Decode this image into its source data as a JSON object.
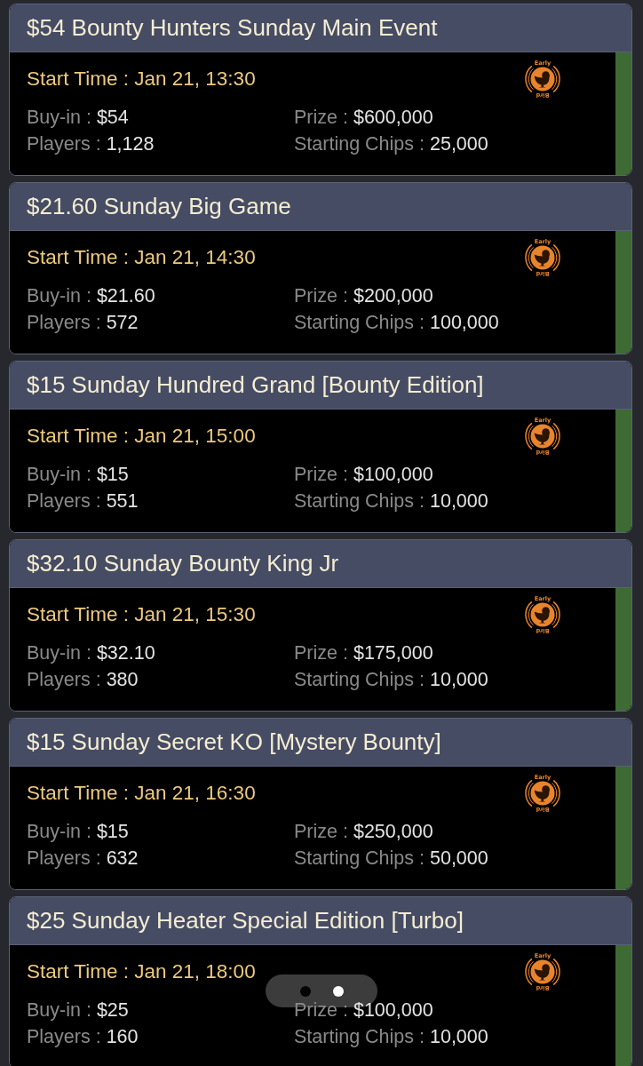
{
  "tournaments": [
    {
      "title": "$54 Bounty Hunters Sunday Main Event",
      "start": "Start Time : Jan 21, 13:30",
      "badge": [
        "Early",
        "Bird"
      ],
      "details": [
        {
          "label": "Buy-in :",
          "value": "$54"
        },
        {
          "label": "Prize :",
          "value": "$600,000"
        },
        {
          "label": "Players :",
          "value": "1,128"
        },
        {
          "label": "Starting Chips :",
          "value": "25,000"
        }
      ]
    },
    {
      "title": "$21.60 Sunday Big Game",
      "start": "Start Time : Jan 21, 14:30",
      "badge": [
        "Early",
        "Bird"
      ],
      "details": [
        {
          "label": "Buy-in :",
          "value": "$21.60"
        },
        {
          "label": "Prize :",
          "value": "$200,000"
        },
        {
          "label": "Players :",
          "value": "572"
        },
        {
          "label": "Starting Chips :",
          "value": "100,000"
        }
      ]
    },
    {
      "title": "$15 Sunday Hundred Grand [Bounty Edition]",
      "start": "Start Time : Jan 21, 15:00",
      "badge": [
        "Early",
        "Bird"
      ],
      "details": [
        {
          "label": "Buy-in :",
          "value": "$15"
        },
        {
          "label": "Prize :",
          "value": "$100,000"
        },
        {
          "label": "Players :",
          "value": "551"
        },
        {
          "label": "Starting Chips :",
          "value": "10,000"
        }
      ]
    },
    {
      "title": "$32.10 Sunday Bounty King Jr",
      "start": "Start Time : Jan 21, 15:30",
      "badge": [
        "Early",
        "Bird"
      ],
      "details": [
        {
          "label": "Buy-in :",
          "value": "$32.10"
        },
        {
          "label": "Prize :",
          "value": "$175,000"
        },
        {
          "label": "Players :",
          "value": "380"
        },
        {
          "label": "Starting Chips :",
          "value": "10,000"
        }
      ]
    },
    {
      "title": "$15 Sunday Secret KO [Mystery Bounty]",
      "start": "Start Time : Jan 21, 16:30",
      "badge": [
        "Early",
        "Bird"
      ],
      "details": [
        {
          "label": "Buy-in :",
          "value": "$15"
        },
        {
          "label": "Prize :",
          "value": "$250,000"
        },
        {
          "label": "Players :",
          "value": "632"
        },
        {
          "label": "Starting Chips :",
          "value": "50,000"
        }
      ]
    },
    {
      "title": "$25 Sunday Heater Special Edition [Turbo]",
      "start": "Start Time : Jan 21, 18:00",
      "badge": [
        "Early",
        "Bird"
      ],
      "details": [
        {
          "label": "Buy-in :",
          "value": "$25"
        },
        {
          "label": "Prize :",
          "value": "$100,000"
        },
        {
          "label": "Players :",
          "value": "160"
        },
        {
          "label": "Starting Chips :",
          "value": "10,000"
        }
      ]
    }
  ],
  "pager": {
    "dots": [
      {
        "selected": false
      },
      {
        "selected": true
      }
    ]
  }
}
